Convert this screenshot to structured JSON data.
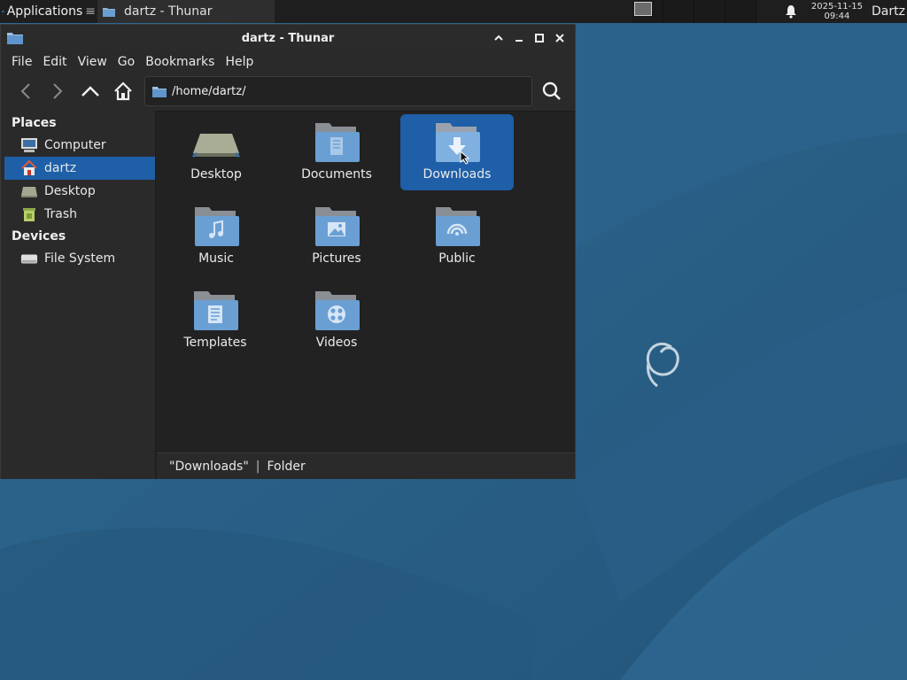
{
  "panel": {
    "apps_label": "Applications",
    "task_label": "dartz - Thunar",
    "clock_date": "2025-11-15",
    "clock_time": "09:44",
    "user_label": "Dartz"
  },
  "window": {
    "title": "dartz - Thunar",
    "menu": [
      "File",
      "Edit",
      "View",
      "Go",
      "Bookmarks",
      "Help"
    ],
    "location": "/home/dartz/"
  },
  "sidebar": {
    "places_heading": "Places",
    "places": [
      {
        "label": "Computer",
        "icon": "computer-icon"
      },
      {
        "label": "dartz",
        "icon": "home-icon",
        "selected": true
      },
      {
        "label": "Desktop",
        "icon": "desktop-icon"
      },
      {
        "label": "Trash",
        "icon": "trash-icon"
      }
    ],
    "devices_heading": "Devices",
    "devices": [
      {
        "label": "File System",
        "icon": "drive-icon"
      }
    ]
  },
  "files": [
    {
      "label": "Desktop",
      "icon": "desktop-folder-icon"
    },
    {
      "label": "Documents",
      "icon": "documents-folder-icon"
    },
    {
      "label": "Downloads",
      "icon": "downloads-folder-icon",
      "selected": true
    },
    {
      "label": "Music",
      "icon": "music-folder-icon"
    },
    {
      "label": "Pictures",
      "icon": "pictures-folder-icon"
    },
    {
      "label": "Public",
      "icon": "public-folder-icon"
    },
    {
      "label": "Templates",
      "icon": "templates-folder-icon"
    },
    {
      "label": "Videos",
      "icon": "videos-folder-icon"
    }
  ],
  "status": {
    "name": "\"Downloads\"",
    "separator": "|",
    "type": "Folder"
  },
  "colors": {
    "selection": "#1e5fa8",
    "desktop_bg": "#2c5f87",
    "folder_blue": "#6a9fd4"
  }
}
